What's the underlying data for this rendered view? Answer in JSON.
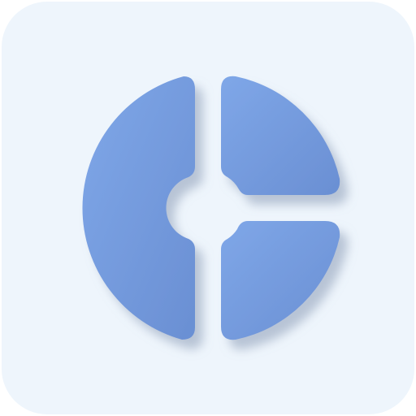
{
  "icon": {
    "name": "app-logo-icon",
    "tile_color": "#eef5fc",
    "logo_color_light": "#7fa7e8",
    "logo_color_dark": "#6a8fd3",
    "shadow_color": "#8a9bb5"
  }
}
